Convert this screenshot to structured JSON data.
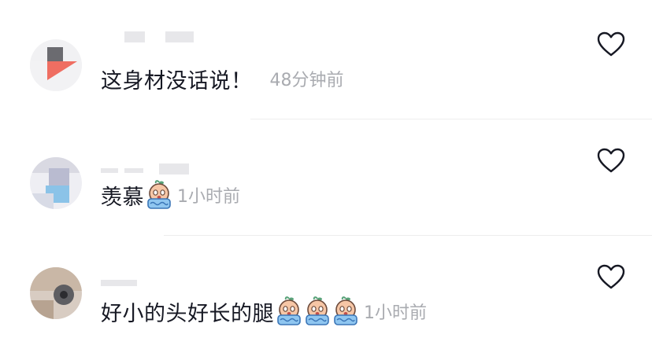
{
  "comments": [
    {
      "text": "这身材没话说！",
      "time": "48分钟前",
      "emoji_count": 0
    },
    {
      "text": "羡慕",
      "time": "1小时前",
      "emoji_count": 1
    },
    {
      "text": "好小的头好长的腿",
      "time": "1小时前",
      "emoji_count": 3
    }
  ],
  "icons": {
    "like": "heart-outline-icon",
    "emoji": "crying-baby-emoji-icon"
  },
  "colors": {
    "text": "#161823",
    "time": "#a9abb0",
    "heart": "#161823",
    "separator": "#ededed"
  }
}
